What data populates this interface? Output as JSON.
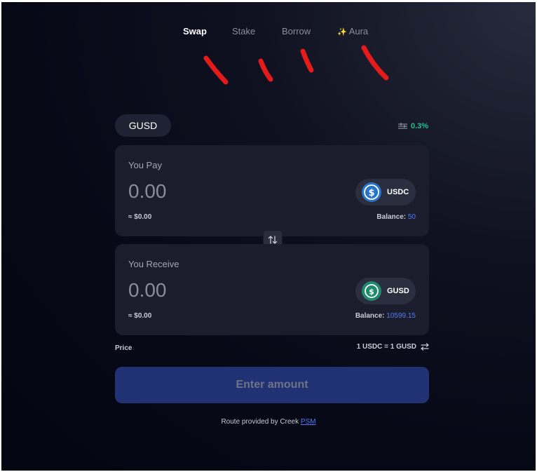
{
  "nav": {
    "tabs": [
      {
        "label": "Swap",
        "active": true
      },
      {
        "label": "Stake",
        "active": false
      },
      {
        "label": "Borrow",
        "active": false
      },
      {
        "label": "Aura",
        "active": false,
        "icon": "sparkle-icon"
      }
    ]
  },
  "token_chip": {
    "label": "GUSD"
  },
  "slippage": {
    "value": "0.3%",
    "icon": "settings-sliders-icon"
  },
  "pay": {
    "label": "You Pay",
    "amount": "0.00",
    "usd": "≈ $0.00",
    "asset": "USDC",
    "balance_label": "Balance:",
    "balance_value": "50"
  },
  "receive": {
    "label": "You Receive",
    "amount": "0.00",
    "usd": "≈ $0.00",
    "asset": "GUSD",
    "balance_label": "Balance:",
    "balance_value": "10599.15"
  },
  "price": {
    "label": "Price",
    "value": "1 USDC = 1 GUSD"
  },
  "cta": {
    "label": "Enter amount"
  },
  "footer": {
    "text": "Route provided by Creek",
    "link": "PSM"
  },
  "colors": {
    "accent": "#4f7cf5",
    "positive": "#1ec38c",
    "cta_bg": "#213274",
    "usdc_blue": "#2775ca",
    "gusd_green": "#1e8a6b",
    "scribble_red": "#e51b1b"
  }
}
